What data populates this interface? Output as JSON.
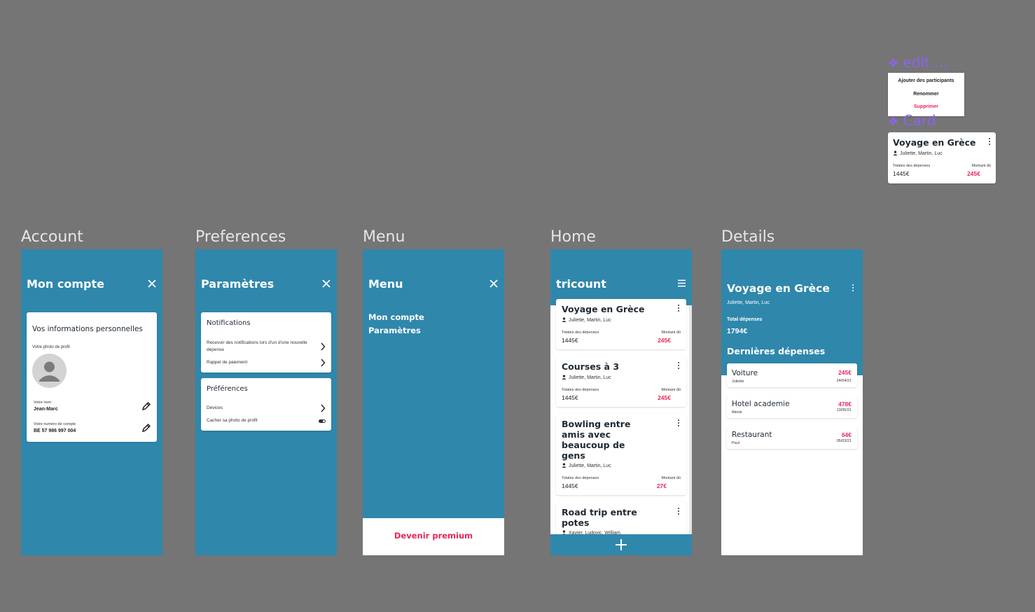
{
  "frames": {
    "account": "Account",
    "preferences": "Preferences",
    "menu": "Menu",
    "home": "Home",
    "details": "Details"
  },
  "components": {
    "edit": {
      "label": "edit ...",
      "items": [
        "Ajouter des participants",
        "Renommer",
        "Supprimer"
      ]
    },
    "card": {
      "label": "Card",
      "title": "Voyage en Grèce",
      "participants": "Juliette, Martin, Luc",
      "total_label": "Totales des dépenses",
      "total_value": "1445€",
      "due_label": "Montant dû",
      "due_value": "245€"
    }
  },
  "account": {
    "title": "Mon compte",
    "section_title": "Vos informations personnelles",
    "photo_label": "Votre photo de profil",
    "name_label": "Votre nom",
    "name_value": "Jean-Marc",
    "account_label": "Votre numéro de compte",
    "account_value": "BE 57 986 997 004"
  },
  "preferences": {
    "title": "Paramètres",
    "notifications_title": "Notifications",
    "notif_item_1": "Recevoir des notifications lors d'un d'une nouvelle dépense",
    "notif_item_2": "Rappel de paiement",
    "prefs_title": "Préférences",
    "pref_item_1": "Devices",
    "pref_item_2": "Cacher sa photo de profil"
  },
  "menu": {
    "title": "Menu",
    "items": [
      "Mon compte",
      "Paramètres"
    ],
    "premium": "Devenir premium"
  },
  "home": {
    "title": "tricount",
    "cards": [
      {
        "title": "Voyage en Grèce",
        "participants": "Juliette, Martin, Luc",
        "total_label": "Totales des dépenses",
        "total": "1445€",
        "due_label": "Montant dû",
        "due": "245€"
      },
      {
        "title": "Courses à 3",
        "participants": "Juliette, Martin, Luc",
        "total_label": "Totales des dépenses",
        "total": "1445€",
        "due_label": "Montant dû",
        "due": "245€"
      },
      {
        "title": "Bowling entre amis avec beaucoup de gens",
        "participants": "Juliette, Martin, Luc",
        "total_label": "Totales des dépenses",
        "total": "1445€",
        "due_label": "Montant dû",
        "due": "27€"
      },
      {
        "title": "Road trip entre potes",
        "participants": "Xavier, Ludovic, William"
      }
    ],
    "add": "+"
  },
  "details": {
    "title": "Voyage en Grèce",
    "participants": "Juliette, Martin, Luc",
    "total_label": "Total dépenses",
    "total_value": "1794€",
    "recent_title": "Dernières dépenses",
    "expenses": [
      {
        "name": "Voiture",
        "person": "Juliette",
        "amount": "245€",
        "date": "24/04/21"
      },
      {
        "name": "Hotel academie",
        "person": "Alexis",
        "amount": "478€",
        "date": "13/05/21"
      },
      {
        "name": "Restaurant",
        "person": "Paul",
        "amount": "64€",
        "date": "05/03/21"
      }
    ]
  },
  "colors": {
    "primary": "#2f87ac",
    "accent": "#e8285a",
    "canvas": "#757575",
    "component_label": "#8a63f0"
  }
}
